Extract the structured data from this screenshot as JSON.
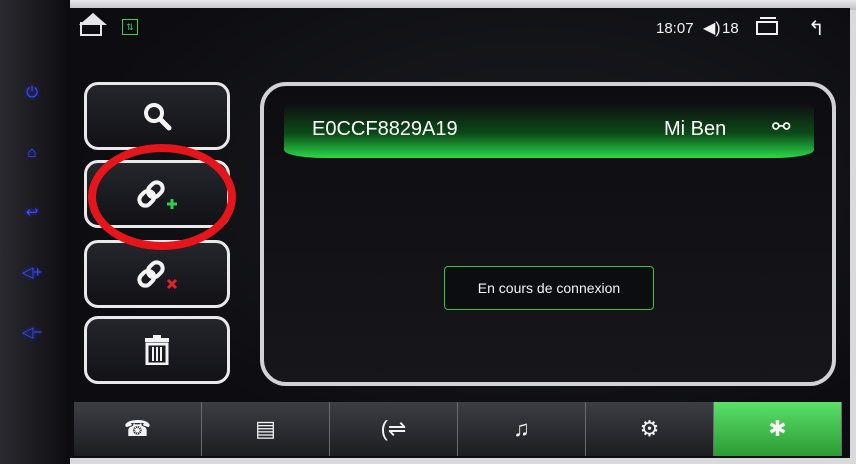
{
  "status": {
    "time": "18:07",
    "volume": "18",
    "volume_icon": "speaker-icon",
    "home_icon": "home-icon",
    "usb_icon": "usb-icon",
    "recent_icon": "recent-apps-icon",
    "back_icon": "back-arrow-icon"
  },
  "hardware_buttons": [
    {
      "name": "power-icon",
      "glyph": "⏻"
    },
    {
      "name": "home-icon",
      "glyph": "⌂"
    },
    {
      "name": "back-icon",
      "glyph": "↩"
    },
    {
      "name": "volume-up-icon",
      "glyph": "◁+"
    },
    {
      "name": "volume-down-icon",
      "glyph": "◁−"
    }
  ],
  "sidebar": {
    "search_icon": "search-icon",
    "pair_icon": "link-add-icon",
    "unpair_icon": "link-remove-icon",
    "delete_icon": "trash-icon"
  },
  "device": {
    "id": "E0CCF8829A19",
    "name": "Mi Ben",
    "action_icon": "unlink-icon"
  },
  "connection": {
    "status": "En cours de connexion"
  },
  "tabs": [
    {
      "icon": "dialpad-icon",
      "active": false
    },
    {
      "icon": "contacts-icon",
      "active": false
    },
    {
      "icon": "call-log-icon",
      "active": false
    },
    {
      "icon": "music-icon",
      "active": false
    },
    {
      "icon": "settings-icon",
      "active": false
    },
    {
      "icon": "bluetooth-icon",
      "active": true
    }
  ],
  "colors": {
    "accent_green": "#2ad94a",
    "annotation_red": "#e4161b",
    "hardware_blue": "#3d4bff"
  }
}
